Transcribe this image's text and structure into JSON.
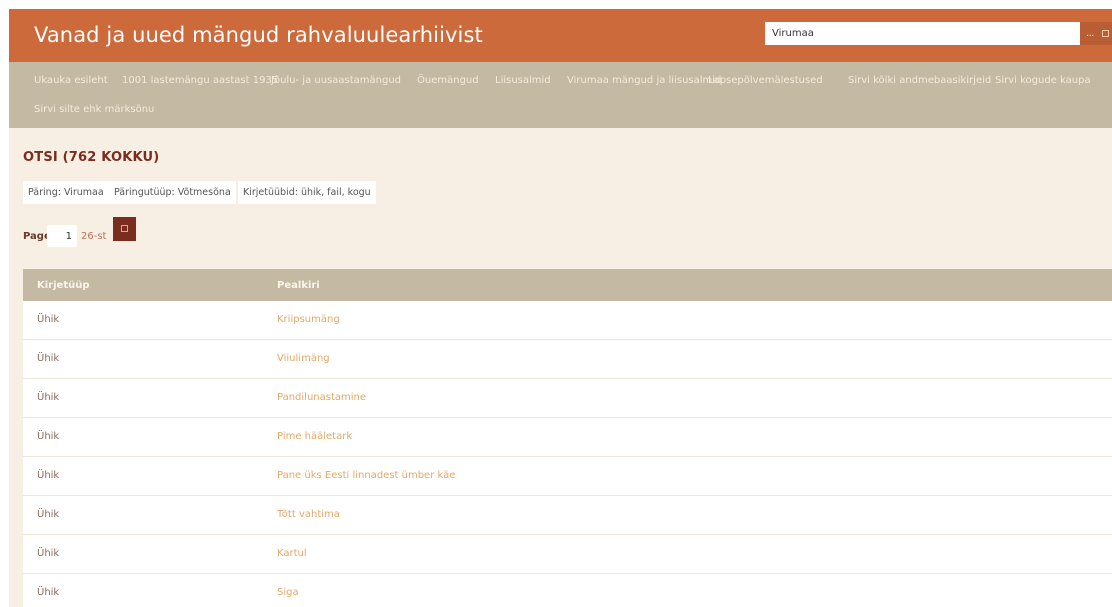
{
  "header": {
    "title": "Vanad ja uued mängud rahvaluulearhiivist",
    "search_value": "Virumaa",
    "search_more": "..."
  },
  "nav": {
    "items": [
      "Ukauka esileht",
      "1001 lastemängu aastast 1935",
      "Jõulu- ja uusaastamängud",
      "Õuemängud",
      "Liisusalmid",
      "Virumaa mängud ja liisusalmid",
      "Lapsepõlvemälestused",
      "Sirvi kõiki andmebaasikirjeid",
      "Sirvi kogude kaupa",
      "Sirvi silte ehk märksõnu"
    ]
  },
  "main": {
    "heading": "OTSI (762 KOKKU)",
    "filters": [
      "Päring: Virumaa",
      "Päringutüüp: Võtmesõna",
      "Kirjetüübid: ühik, fail, kogu"
    ],
    "pager": {
      "label": "Page",
      "value": "1",
      "of_text": "26-st"
    }
  },
  "table": {
    "headers": [
      "Kirjetüüp",
      "Pealkiri"
    ],
    "rows": [
      {
        "type": "Ühik",
        "title": "Kriipsumäng"
      },
      {
        "type": "Ühik",
        "title": "Viiulimäng"
      },
      {
        "type": "Ühik",
        "title": "Pandilunastamine"
      },
      {
        "type": "Ühik",
        "title": "Pime hääletark"
      },
      {
        "type": "Ühik",
        "title": "Pane üks Eesti linnadest ümber käe"
      },
      {
        "type": "Ühik",
        "title": "Tõtt vahtima"
      },
      {
        "type": "Ühik",
        "title": "Kartul"
      },
      {
        "type": "Ühik",
        "title": "Siga"
      }
    ]
  },
  "colors": {
    "header_bg": "#cd6a3c",
    "nav_bg": "#c4b9a3",
    "content_bg": "#f7efe4",
    "heading_color": "#7a2d1f",
    "link_color": "#e3a868"
  }
}
